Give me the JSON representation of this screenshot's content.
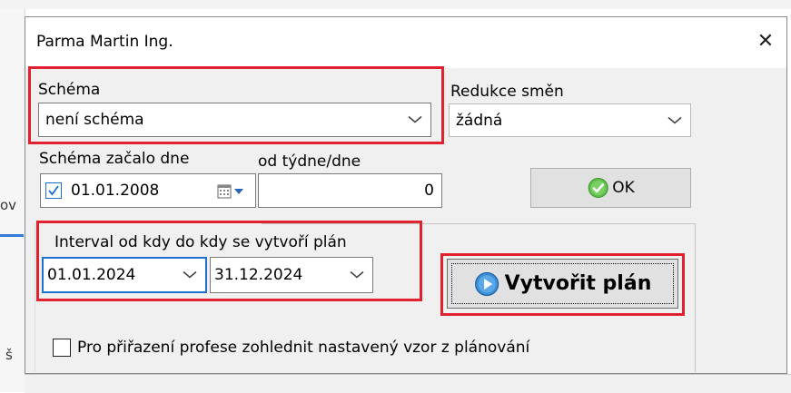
{
  "background": {
    "left_glyph_top": "ov",
    "left_glyph_bottom": "š"
  },
  "dialog": {
    "title": "Parma Martin Ing.",
    "close_glyph": "✕"
  },
  "schema": {
    "label": "Schéma",
    "value": "není schéma"
  },
  "reduction": {
    "label": "Redukce směn",
    "value": "žádná"
  },
  "start": {
    "label": "Schéma začalo dne",
    "date": "01.01.2008",
    "checked": true,
    "week_label": "od týdne/dne",
    "week_value": "0"
  },
  "ok_button": {
    "label": "OK",
    "icon": "green-check-icon"
  },
  "interval": {
    "label": "Interval od kdy do kdy se vytvoří plán",
    "from": "01.01.2024",
    "to": "31.12.2024"
  },
  "create_button": {
    "label": "Vytvořit plán",
    "icon": "blue-play-icon"
  },
  "profession_checkbox": {
    "label": "Pro přiřazení profese zohlednit nastavený vzor z plánování",
    "checked": false
  },
  "colors": {
    "highlight": "#e0212e",
    "accent": "#2f7bd6",
    "dialog_bg": "#f0f0f0"
  }
}
